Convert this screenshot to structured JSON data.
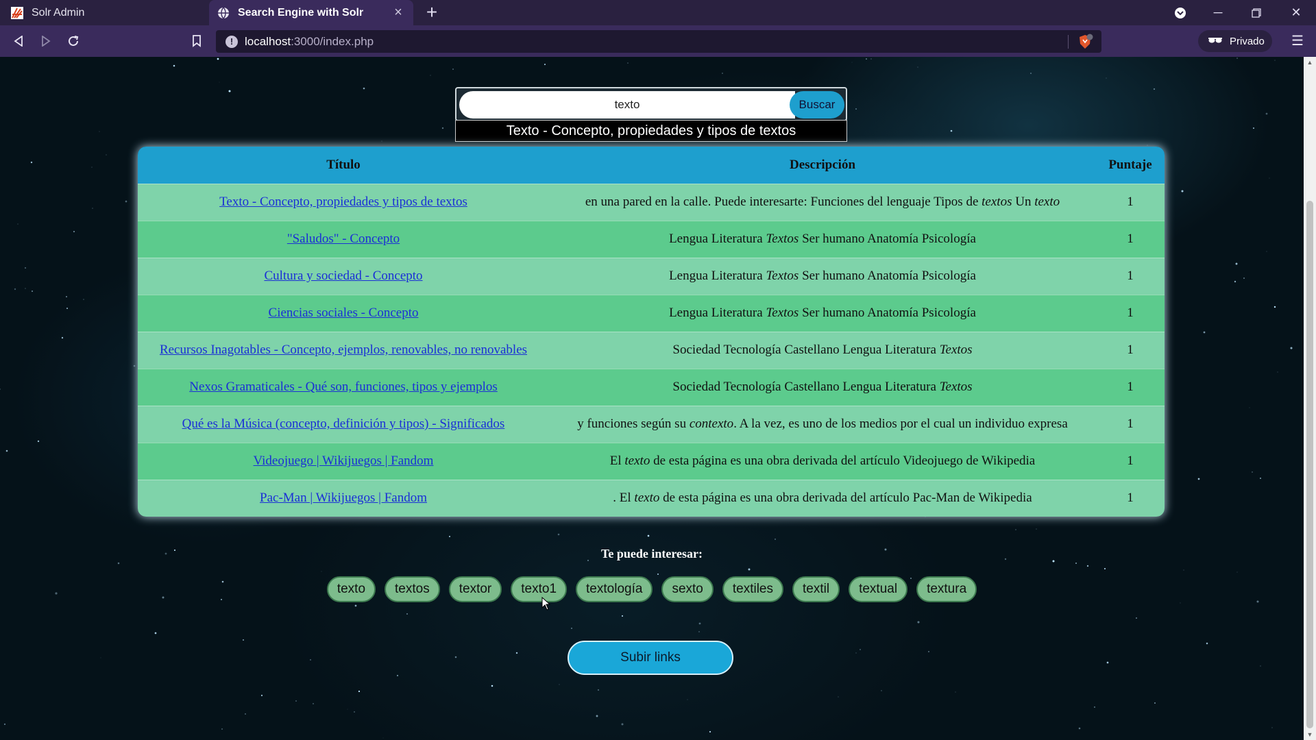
{
  "browser": {
    "tabs": [
      {
        "label": "Solr Admin",
        "favicon": "solr-logo-icon",
        "active": false
      },
      {
        "label": "Search Engine with Solr",
        "favicon": "globe-icon",
        "active": true
      }
    ],
    "url_host": "localhost",
    "url_path": ":3000/index.php",
    "private_label": "Privado",
    "shield_count": "1"
  },
  "search": {
    "value": "texto",
    "button_label": "Buscar",
    "suggestion": "Texto - Concepto, propiedades y tipos de textos"
  },
  "table": {
    "headers": [
      "Título",
      "Descripción",
      "Puntaje"
    ],
    "rows": [
      {
        "title": "Texto - Concepto, propiedades y tipos de textos",
        "description": "en una pared en la calle. Puede interesarte: Funciones del lenguaje Tipos de <em>textos</em> Un <em>texto</em>",
        "score": "1"
      },
      {
        "title": "\"Saludos\" - Concepto",
        "description": "Lengua Literatura <em>Textos</em> Ser humano Anatomía Psicología",
        "score": "1"
      },
      {
        "title": "Cultura y sociedad - Concepto",
        "description": "Lengua Literatura <em>Textos</em> Ser humano Anatomía Psicología",
        "score": "1"
      },
      {
        "title": "Ciencias sociales - Concepto",
        "description": "Lengua Literatura <em>Textos</em> Ser humano Anatomía Psicología",
        "score": "1"
      },
      {
        "title": "Recursos Inagotables - Concepto, ejemplos, renovables, no renovables",
        "description": "Sociedad Tecnología Castellano Lengua Literatura <em>Textos</em>",
        "score": "1"
      },
      {
        "title": "Nexos Gramaticales - Qué son, funciones, tipos y ejemplos",
        "description": "Sociedad Tecnología Castellano Lengua Literatura <em>Textos</em>",
        "score": "1"
      },
      {
        "title": "Qué es la Música (concepto, definición y tipos) - Significados",
        "description": "y funciones según su <em>contexto</em>. A la vez, es uno de los medios por el cual un individuo expresa",
        "score": "1"
      },
      {
        "title": "Videojuego | Wikijuegos | Fandom",
        "description": "El <em>texto</em> de esta página es una obra derivada del artículo Videojuego de Wikipedia",
        "score": "1"
      },
      {
        "title": "Pac-Man | Wikijuegos | Fandom",
        "description": ". El <em>texto</em> de esta página es una obra derivada del artículo Pac-Man de Wikipedia",
        "score": "1"
      }
    ]
  },
  "suggestions": {
    "label": "Te puede interesar:",
    "chips": [
      "texto",
      "textos",
      "textor",
      "texto1",
      "textología",
      "sexto",
      "textiles",
      "textil",
      "textual",
      "textura"
    ]
  },
  "upload_button_label": "Subir links"
}
